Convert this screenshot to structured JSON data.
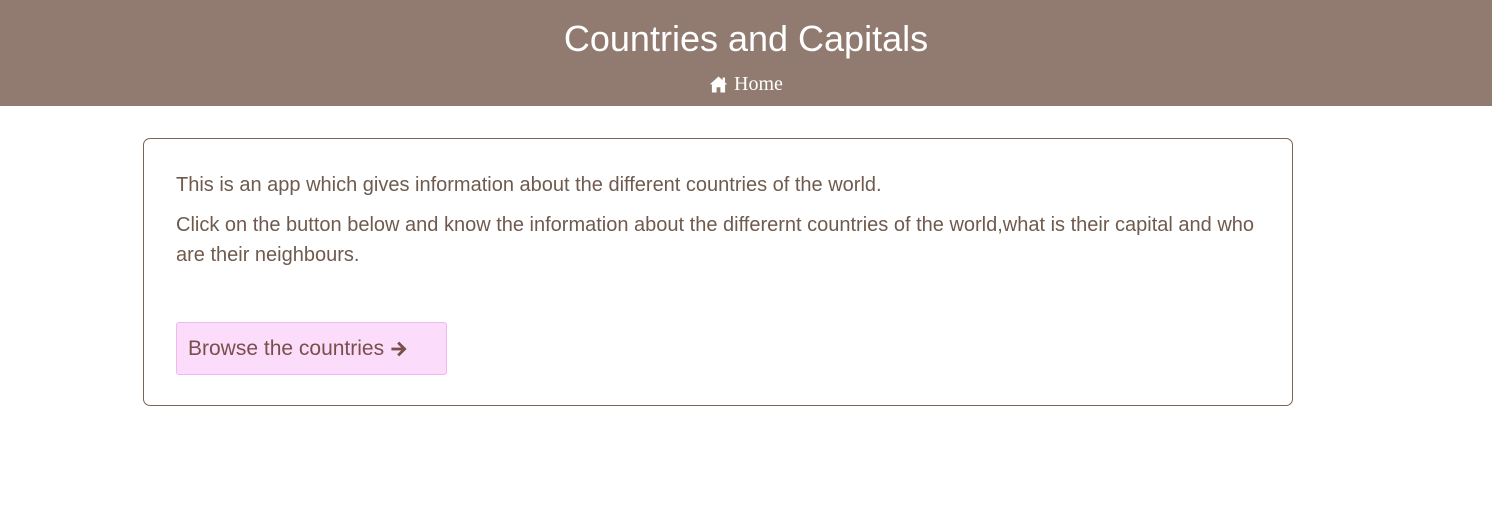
{
  "header": {
    "title": "Countries and Capitals",
    "nav": {
      "home_label": "Home",
      "home_icon": "home-icon"
    },
    "background_color": "#917b70"
  },
  "main": {
    "paragraphs": [
      "This is an app which gives information about the different countries of the world.",
      "Click on the button below and know the information about the differernt countries of the world,what is their capital and who are their neighbours."
    ],
    "browse_button": {
      "label": "Browse the countries",
      "icon": "arrow-right-icon",
      "background_color": "#fbdcfb"
    }
  }
}
